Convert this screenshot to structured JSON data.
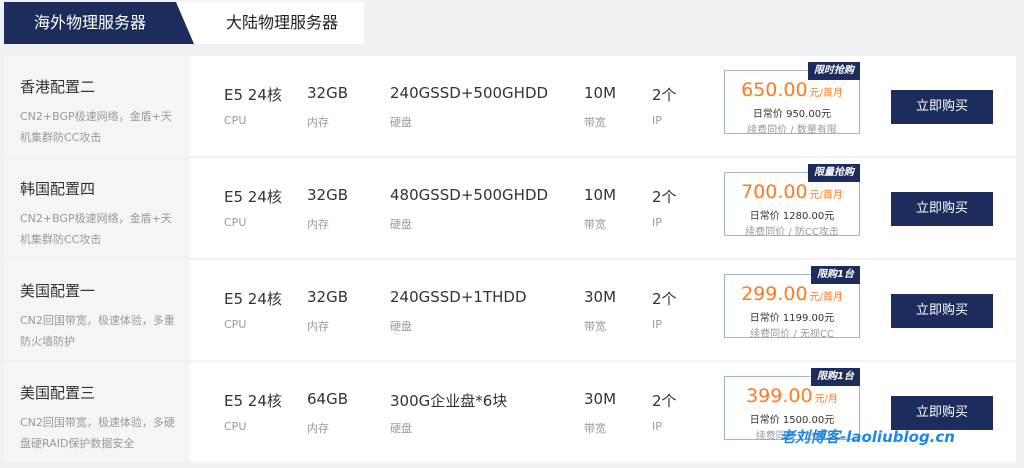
{
  "tabs": [
    "海外物理服务器",
    "大陆物理服务器"
  ],
  "labels": {
    "cpu": "CPU",
    "ram": "内存",
    "disk": "硬盘",
    "bandwidth": "带宽",
    "ip": "IP",
    "buy": "立即购买"
  },
  "rows": [
    {
      "title": "香港配置二",
      "desc": "CN2+BGP极速网络，金盾+天机集群防CC攻击",
      "cpu": "E5 24核",
      "ram": "32GB",
      "disk": "240GSSD+500GHDD",
      "bandwidth": "10M",
      "ip": "2个",
      "tag": "限时抢购",
      "price": "650.00",
      "unit": "元/首月",
      "daily": "日常价 950.00元",
      "note": "续费同价 / 数量有限"
    },
    {
      "title": "韩国配置四",
      "desc": "CN2+BGP极速网络，金盾+天机集群防CC攻击",
      "cpu": "E5 24核",
      "ram": "32GB",
      "disk": "480GSSD+500GHDD",
      "bandwidth": "10M",
      "ip": "2个",
      "tag": "限量抢购",
      "price": "700.00",
      "unit": "元/首月",
      "daily": "日常价 1280.00元",
      "note": "续费同价 / 防CC攻击"
    },
    {
      "title": "美国配置一",
      "desc": "CN2回国带宽，极速体验，多重防火墙防护",
      "cpu": "E5 24核",
      "ram": "32GB",
      "disk": "240GSSD+1THDD",
      "bandwidth": "30M",
      "ip": "2个",
      "tag": "限购1台",
      "price": "299.00",
      "unit": "元/首月",
      "daily": "日常价 1199.00元",
      "note": "续费同价 / 无视CC"
    },
    {
      "title": "美国配置三",
      "desc": "CN2回国带宽，极速体验，多硬盘硬RAID保护数据安全",
      "cpu": "E5 24核",
      "ram": "64GB",
      "disk": "300G企业盘*6块",
      "bandwidth": "30M",
      "ip": "2个",
      "tag": "限购1台",
      "price": "399.00",
      "unit": "元/月",
      "daily": "日常价 1500.00元",
      "note": "续费同价 / 10…"
    }
  ],
  "watermark": "老刘博客-laoliublog.cn",
  "colors": {
    "primary": "#1c2c5c",
    "price": "#ff7a24",
    "border": "#9fb4d0"
  }
}
